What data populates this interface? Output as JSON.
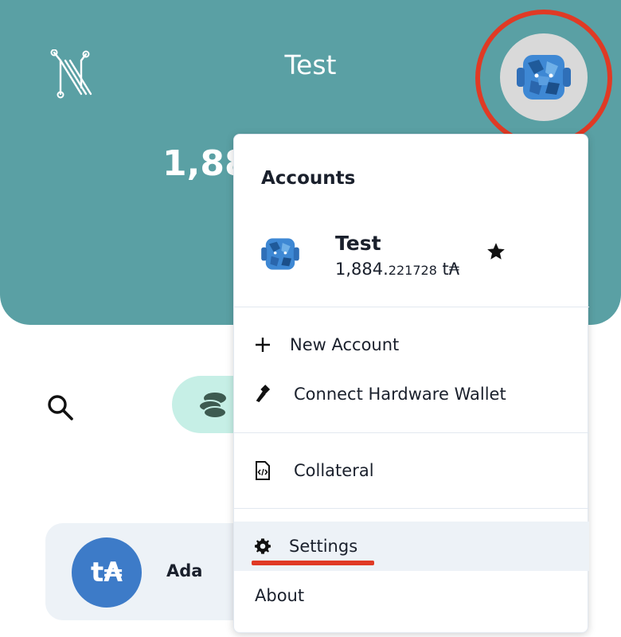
{
  "header": {
    "wallet_name": "Test",
    "balance_partial": "1,88"
  },
  "menu": {
    "heading": "Accounts",
    "account": {
      "name": "Test",
      "balance_main": "1,884.",
      "balance_decimals": "221728",
      "balance_unit": " t₳",
      "star_icon": "star-icon"
    },
    "items": [
      {
        "label": "New Account",
        "icon": "plus-icon"
      },
      {
        "label": "Connect Hardware Wallet",
        "icon": "usb-icon"
      },
      {
        "label": "Collateral",
        "icon": "file-code-icon"
      },
      {
        "label": "Settings",
        "icon": "gear-icon"
      },
      {
        "label": "About",
        "icon": ""
      }
    ]
  },
  "assets": {
    "row": {
      "badge": "t₳",
      "name": "Ada"
    }
  },
  "colors": {
    "header_bg": "#5aa0a4",
    "highlight": "#e03a25",
    "asset_badge": "#3d7bc8",
    "toggle_bg": "#c6efe6"
  }
}
